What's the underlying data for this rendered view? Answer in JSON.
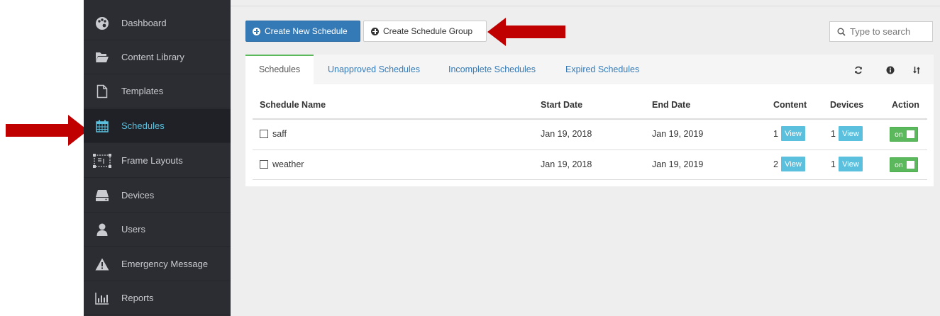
{
  "sidebar": {
    "items": [
      {
        "label": "Dashboard",
        "icon": "palette-icon"
      },
      {
        "label": "Content Library",
        "icon": "folder-open-icon"
      },
      {
        "label": "Templates",
        "icon": "file-icon"
      },
      {
        "label": "Schedules",
        "icon": "calendar-icon"
      },
      {
        "label": "Frame Layouts",
        "icon": "frame-layout-icon"
      },
      {
        "label": "Devices",
        "icon": "hard-drive-icon"
      },
      {
        "label": "Users",
        "icon": "user-icon"
      },
      {
        "label": "Emergency Message",
        "icon": "warning-icon"
      },
      {
        "label": "Reports",
        "icon": "bar-chart-icon"
      }
    ],
    "active_item": "Schedules"
  },
  "toolbar": {
    "create_schedule_label": "Create New Schedule",
    "create_group_label": "Create Schedule Group",
    "search_placeholder": "Type to search"
  },
  "tabs": {
    "items": [
      "Schedules",
      "Unapproved Schedules",
      "Incomplete Schedules",
      "Expired Schedules"
    ],
    "active": "Schedules"
  },
  "table": {
    "columns": [
      "Schedule Name",
      "Start Date",
      "End Date",
      "Content",
      "Devices",
      "Action"
    ],
    "rows": [
      {
        "name": "saff",
        "start": "Jan 19, 2018",
        "end": "Jan 19, 2019",
        "content_count": "1",
        "devices_count": "1",
        "view_label": "View",
        "toggle_label": "on"
      },
      {
        "name": "weather",
        "start": "Jan 19, 2018",
        "end": "Jan 19, 2019",
        "content_count": "2",
        "devices_count": "1",
        "view_label": "View",
        "toggle_label": "on"
      }
    ]
  },
  "colors": {
    "sidebar_bg": "#2b2d33",
    "active_text": "#5bc0de",
    "primary": "#337ab7",
    "info": "#5bc0de",
    "success": "#5cb85c",
    "annotation_arrow": "#c00000"
  }
}
